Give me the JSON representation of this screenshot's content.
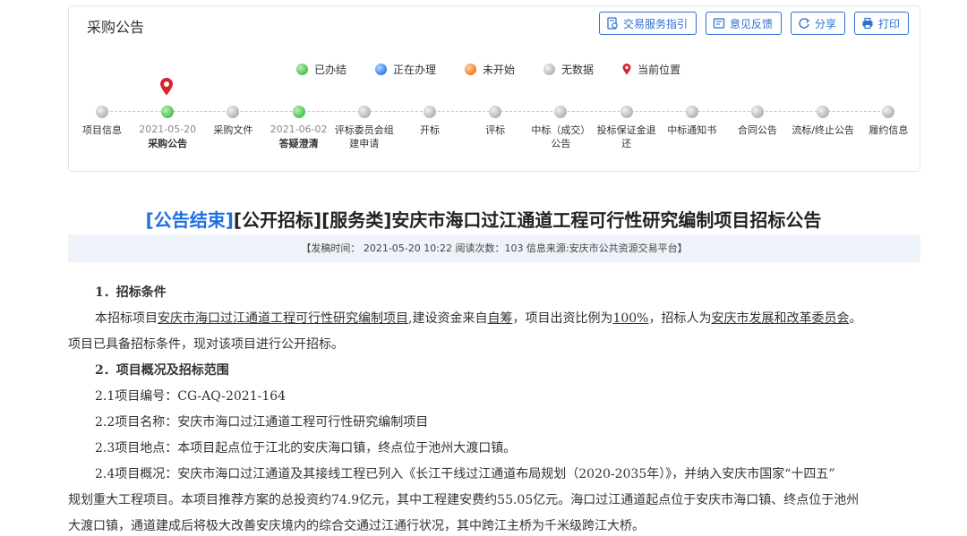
{
  "panel": {
    "title": "采购公告",
    "buttons": [
      {
        "label": "交易服务指引",
        "icon": "guide-icon"
      },
      {
        "label": "意见反馈",
        "icon": "feedback-icon"
      },
      {
        "label": "分享",
        "icon": "share-icon"
      },
      {
        "label": "打印",
        "icon": "print-icon"
      }
    ]
  },
  "legend": [
    {
      "label": "已办结",
      "status": "done"
    },
    {
      "label": "正在办理",
      "status": "doing"
    },
    {
      "label": "未开始",
      "status": "todo"
    },
    {
      "label": "无数据",
      "status": "none"
    },
    {
      "label": "当前位置",
      "status": "pin"
    }
  ],
  "steps": [
    {
      "label": "项目信息",
      "status": "none",
      "date": ""
    },
    {
      "label": "采购公告",
      "status": "done",
      "date": "2021-05-20",
      "current": true
    },
    {
      "label": "采购文件",
      "status": "none",
      "date": ""
    },
    {
      "label": "答疑澄清",
      "status": "done",
      "date": "2021-06-02"
    },
    {
      "label": "评标委员会组建申请",
      "status": "none",
      "date": ""
    },
    {
      "label": "开标",
      "status": "none",
      "date": ""
    },
    {
      "label": "评标",
      "status": "none",
      "date": ""
    },
    {
      "label": "中标（成交）公告",
      "status": "none",
      "date": ""
    },
    {
      "label": "投标保证金退还",
      "status": "none",
      "date": ""
    },
    {
      "label": "中标通知书",
      "status": "none",
      "date": ""
    },
    {
      "label": "合同公告",
      "status": "none",
      "date": ""
    },
    {
      "label": "流标/终止公告",
      "status": "none",
      "date": ""
    },
    {
      "label": "履约信息",
      "status": "none",
      "date": ""
    }
  ],
  "article": {
    "tag": "[公告结束]",
    "title_rest": "[公开招标][服务类]安庆市海口过江通道工程可行性研究编制项目招标公告",
    "meta": "【发稿时间： 2021-05-20 10:22    阅读次数：103    信息来源:安庆市公共资源交易平台】",
    "h1": "1．招标条件",
    "p1a": "本招标项目",
    "p1_project": "安庆市海口过江通道工程可行性研究编制项目",
    "p1b": ",建设资金来自",
    "p1_fund": "自筹",
    "p1c": "，项目出资比例为",
    "p1_ratio": "100%",
    "p1d": "，招标人为",
    "p1_owner": "安庆市发展和改革委员会",
    "p1e": "。",
    "p1_line2": "项目已具备招标条件，现对该项目进行公开招标。",
    "h2": "2．项目概况及招标范围",
    "item1": "2.1项目编号：CG-AQ-2021-164",
    "item2": "2.2项目名称：安庆市海口过江通道工程可行性研究编制项目",
    "item3": "2.3项目地点：本项目起点位于江北的安庆海口镇，终点位于池州大渡口镇。",
    "item4_l1": "2.4项目概况：安庆市海口过江通道及其接线工程已列入《长江干线过江通道布局规划（2020-2035年）》，并纳入安庆市国家“十四五”",
    "item4_l2": "规划重大工程项目。本项目推荐方案的总投资约74.9亿元，其中工程建安费约55.05亿元。海口过江通道起点位于安庆市海口镇、终点位于池州",
    "item4_l3": "大渡口镇，通道建成后将极大改善安庆境内的综合交通过江通行状况，其中跨江主桥为千米级跨江大桥。"
  }
}
